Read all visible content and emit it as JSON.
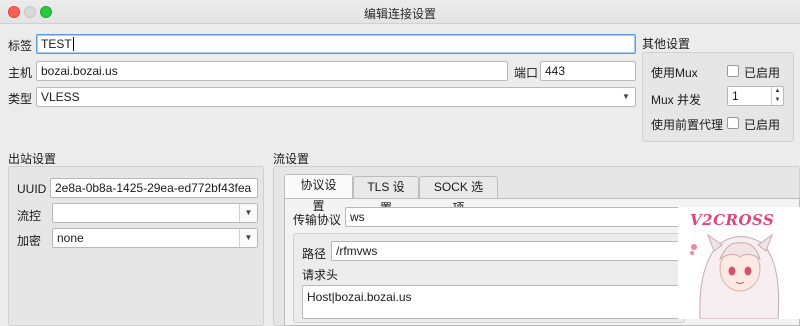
{
  "window": {
    "title": "编辑连接设置"
  },
  "main": {
    "tag_label": "标签",
    "tag_value": "TEST",
    "host_label": "主机",
    "host_value": "bozai.bozai.us",
    "port_label": "端口",
    "port_value": "443",
    "type_label": "类型",
    "type_value": "VLESS"
  },
  "other_settings": {
    "title": "其他设置",
    "use_mux_label": "使用Mux",
    "use_mux_checkbox_label": "已启用",
    "use_mux_checked": false,
    "mux_concurrency_label": "Mux 并发",
    "mux_concurrency_value": "1",
    "use_front_proxy_label": "使用前置代理",
    "use_front_proxy_checkbox_label": "已启用",
    "use_front_proxy_checked": false
  },
  "outbound": {
    "title": "出站设置",
    "uuid_label": "UUID",
    "uuid_value": "2e8a-0b8a-1425-29ea-ed772bf43fea",
    "flow_label": "流控",
    "flow_value": "",
    "encryption_label": "加密",
    "encryption_value": "none"
  },
  "stream": {
    "title": "流设置",
    "tabs": [
      {
        "label": "协议设置",
        "active": true
      },
      {
        "label": "TLS 设置",
        "active": false
      },
      {
        "label": "SOCK 选项",
        "active": false
      }
    ],
    "transport_label": "传输协议",
    "transport_value": "ws",
    "path_label": "路径",
    "path_value": "/rfmvws",
    "headers_label": "请求头",
    "headers_value": "Host|bozai.bozai.us"
  },
  "watermark": {
    "logo_text": "V2CROSS"
  },
  "colors": {
    "window_bg": "#ececec",
    "focus_border": "#5c9bd6",
    "traffic_red": "#fd5f57",
    "traffic_green": "#28c840",
    "logo_pink": "#e0457b"
  },
  "icons": {
    "close": "close-icon",
    "minimize": "minimize-icon",
    "zoom": "zoom-icon",
    "dropdown": "chevron-down-icon"
  }
}
